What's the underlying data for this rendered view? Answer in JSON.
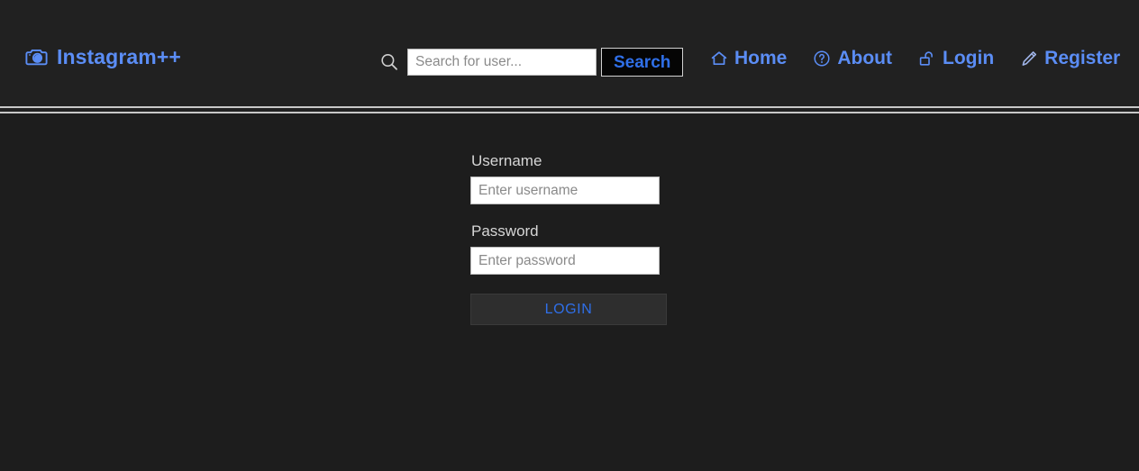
{
  "page": {
    "background_color": "#1d1d1d",
    "accent_color": "#5b8df5",
    "link_color": "#2f6fe8"
  },
  "header": {
    "brand": {
      "icon": "camera-icon",
      "text": "Instagram++"
    },
    "search": {
      "icon": "search-icon",
      "placeholder": "Search for user...",
      "value": "",
      "button_label": "Search"
    },
    "nav": [
      {
        "label": "Home",
        "icon": "home-icon"
      },
      {
        "label": "About",
        "icon": "question-circle-icon"
      },
      {
        "label": "Login",
        "icon": "unlocked-padlock-icon"
      },
      {
        "label": "Register",
        "icon": "pencil-icon"
      }
    ]
  },
  "login_form": {
    "username_label": "Username",
    "username_placeholder": "Enter username",
    "username_value": "",
    "password_label": "Password",
    "password_placeholder": "Enter password",
    "password_value": "",
    "submit_label": "LOGIN"
  }
}
